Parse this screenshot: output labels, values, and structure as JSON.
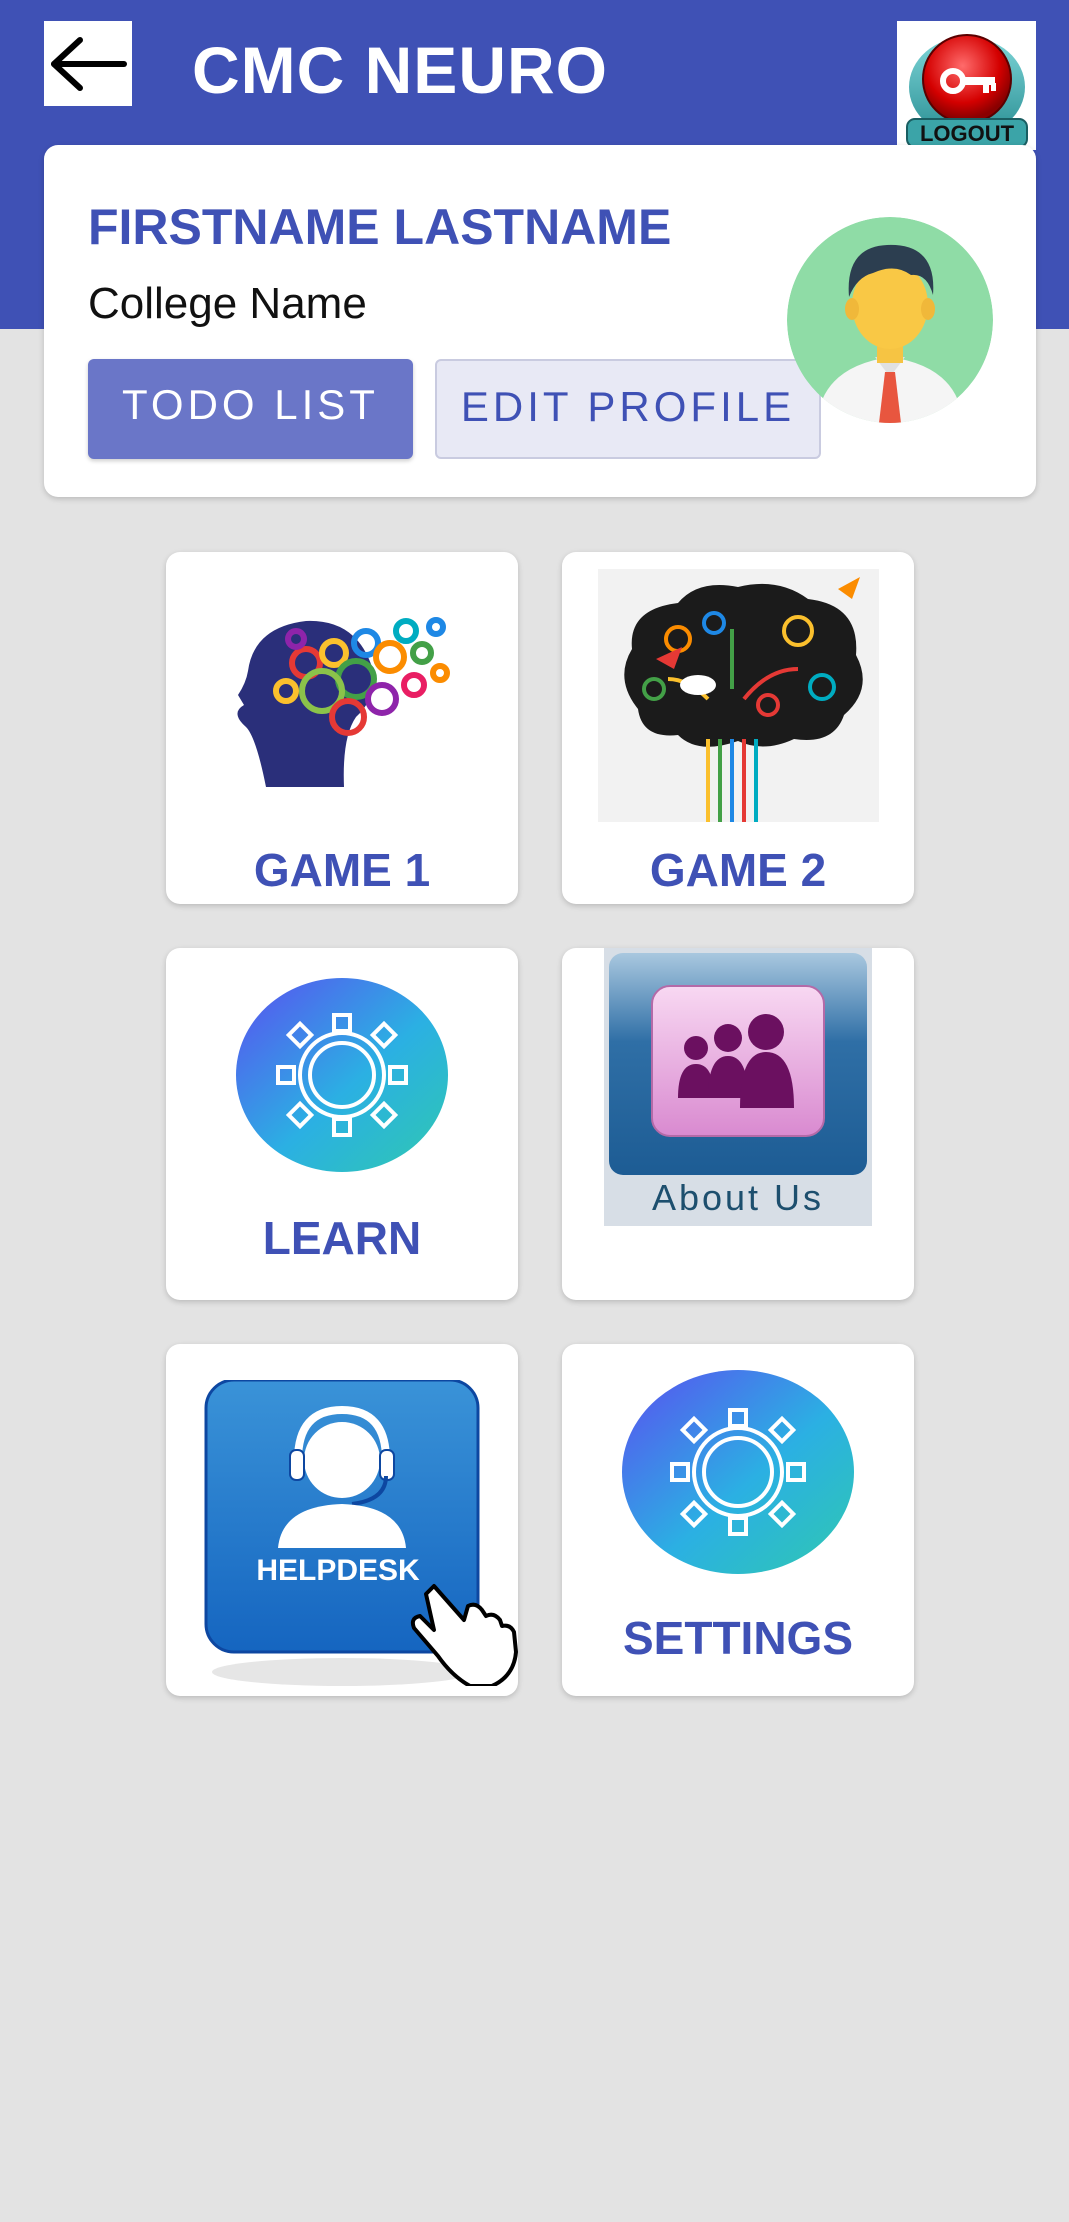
{
  "header": {
    "title": "CMC NEURO",
    "back_icon": "arrow-left-icon",
    "logout_label": "LOGOUT",
    "color": "#3f51b5"
  },
  "profile": {
    "name": "FIRSTNAME LASTNAME",
    "college": "College Name",
    "todo_label": "TODO LIST",
    "edit_label": "EDIT PROFILE",
    "avatar_icon": "user-avatar-icon"
  },
  "tiles": [
    {
      "label": "GAME 1",
      "icon": "brain-gears-icon"
    },
    {
      "label": "GAME 2",
      "icon": "brain-circuit-icon"
    },
    {
      "label": "LEARN",
      "icon": "gear-icon"
    },
    {
      "label": "About Us",
      "icon": "group-icon"
    },
    {
      "label": "HELPDESK",
      "icon": "helpdesk-icon"
    },
    {
      "label": "SETTINGS",
      "icon": "gear-icon"
    }
  ]
}
